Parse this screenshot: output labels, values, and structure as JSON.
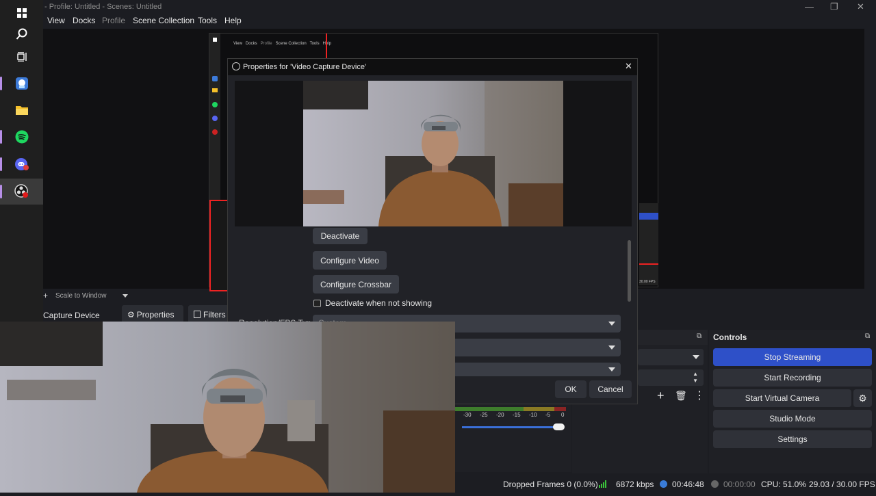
{
  "window": {
    "title": "- Profile: Untitled - Scenes: Untitled"
  },
  "menu": {
    "items": [
      "View",
      "Docks",
      "Profile",
      "Scene Collection",
      "Tools",
      "Help"
    ]
  },
  "taskbar": {
    "icons": [
      "windows-start-icon",
      "search-icon",
      "task-view-icon",
      "app-icon",
      "file-explorer-icon",
      "spotify-icon",
      "discord-icon",
      "obs-icon"
    ]
  },
  "inner_screenshot": {
    "menu": [
      "View",
      "Docks",
      "Profile",
      "Scene Collection",
      "Tools",
      "Help"
    ],
    "fps": "30.00 FPS"
  },
  "preview_toolbar": {
    "scale_label": "Scale to Window"
  },
  "source_bar": {
    "source_name": "Capture Device",
    "properties_label": "Properties",
    "filters_label": "Filters"
  },
  "dialog": {
    "title": "Properties for 'Video Capture Device'",
    "deactivate_label": "Deactivate",
    "configure_video_label": "Configure Video",
    "configure_crossbar_label": "Configure Crossbar",
    "deactivate_when_not_showing_label": "Deactivate when not showing",
    "resolution_label": "Resolution/FPS Type",
    "resolution_value": "Custom",
    "ok_label": "OK",
    "cancel_label": "Cancel"
  },
  "controls": {
    "title": "Controls",
    "stop_streaming": "Stop Streaming",
    "start_recording": "Start Recording",
    "start_virtual_camera": "Start Virtual Camera",
    "studio_mode": "Studio Mode",
    "settings": "Settings",
    "accent": "#2e50c8"
  },
  "mixer": {
    "ticks": [
      "-30",
      "-25",
      "-20",
      "-15",
      "-10",
      "-5",
      "0"
    ]
  },
  "status": {
    "dropped_frames": "Dropped Frames 0 (0.0%)",
    "bitrate": "6872 kbps",
    "stream_time": "00:46:48",
    "record_time": "00:00:00",
    "cpu": "CPU: 51.0%",
    "fps": "29.03 / 30.00 FPS"
  }
}
